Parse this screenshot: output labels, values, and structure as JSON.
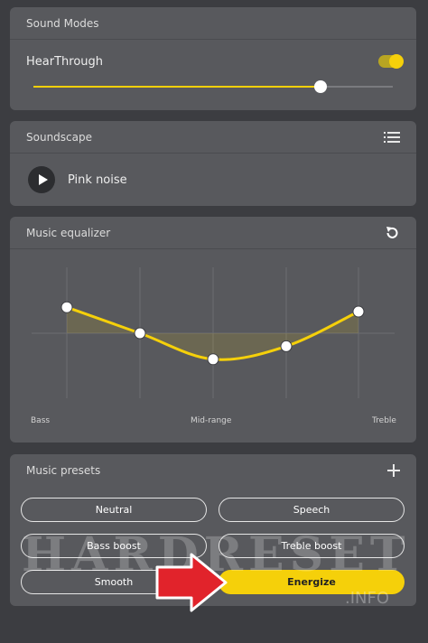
{
  "sound_modes": {
    "title": "Sound Modes",
    "mode_label": "HearThrough",
    "toggle_on": true,
    "level": 0.8
  },
  "soundscape": {
    "title": "Soundscape",
    "track": "Pink noise",
    "icons": [
      "list-icon",
      "play-icon"
    ]
  },
  "equalizer": {
    "title": "Music equalizer",
    "labels": {
      "left": "Bass",
      "middle": "Mid-range",
      "right": "Treble"
    },
    "bands": [
      0.6,
      0.0,
      -0.6,
      -0.3,
      0.5
    ],
    "accent": "#f5d00a"
  },
  "presets": {
    "title": "Music presets",
    "items": [
      {
        "label": "Neutral",
        "active": false
      },
      {
        "label": "Speech",
        "active": false
      },
      {
        "label": "Bass boost",
        "active": false
      },
      {
        "label": "Treble boost",
        "active": false
      },
      {
        "label": "Smooth",
        "active": false
      },
      {
        "label": "Energize",
        "active": true
      }
    ]
  },
  "watermark": {
    "main": "HARDRESET",
    "sub": ".INFO"
  }
}
